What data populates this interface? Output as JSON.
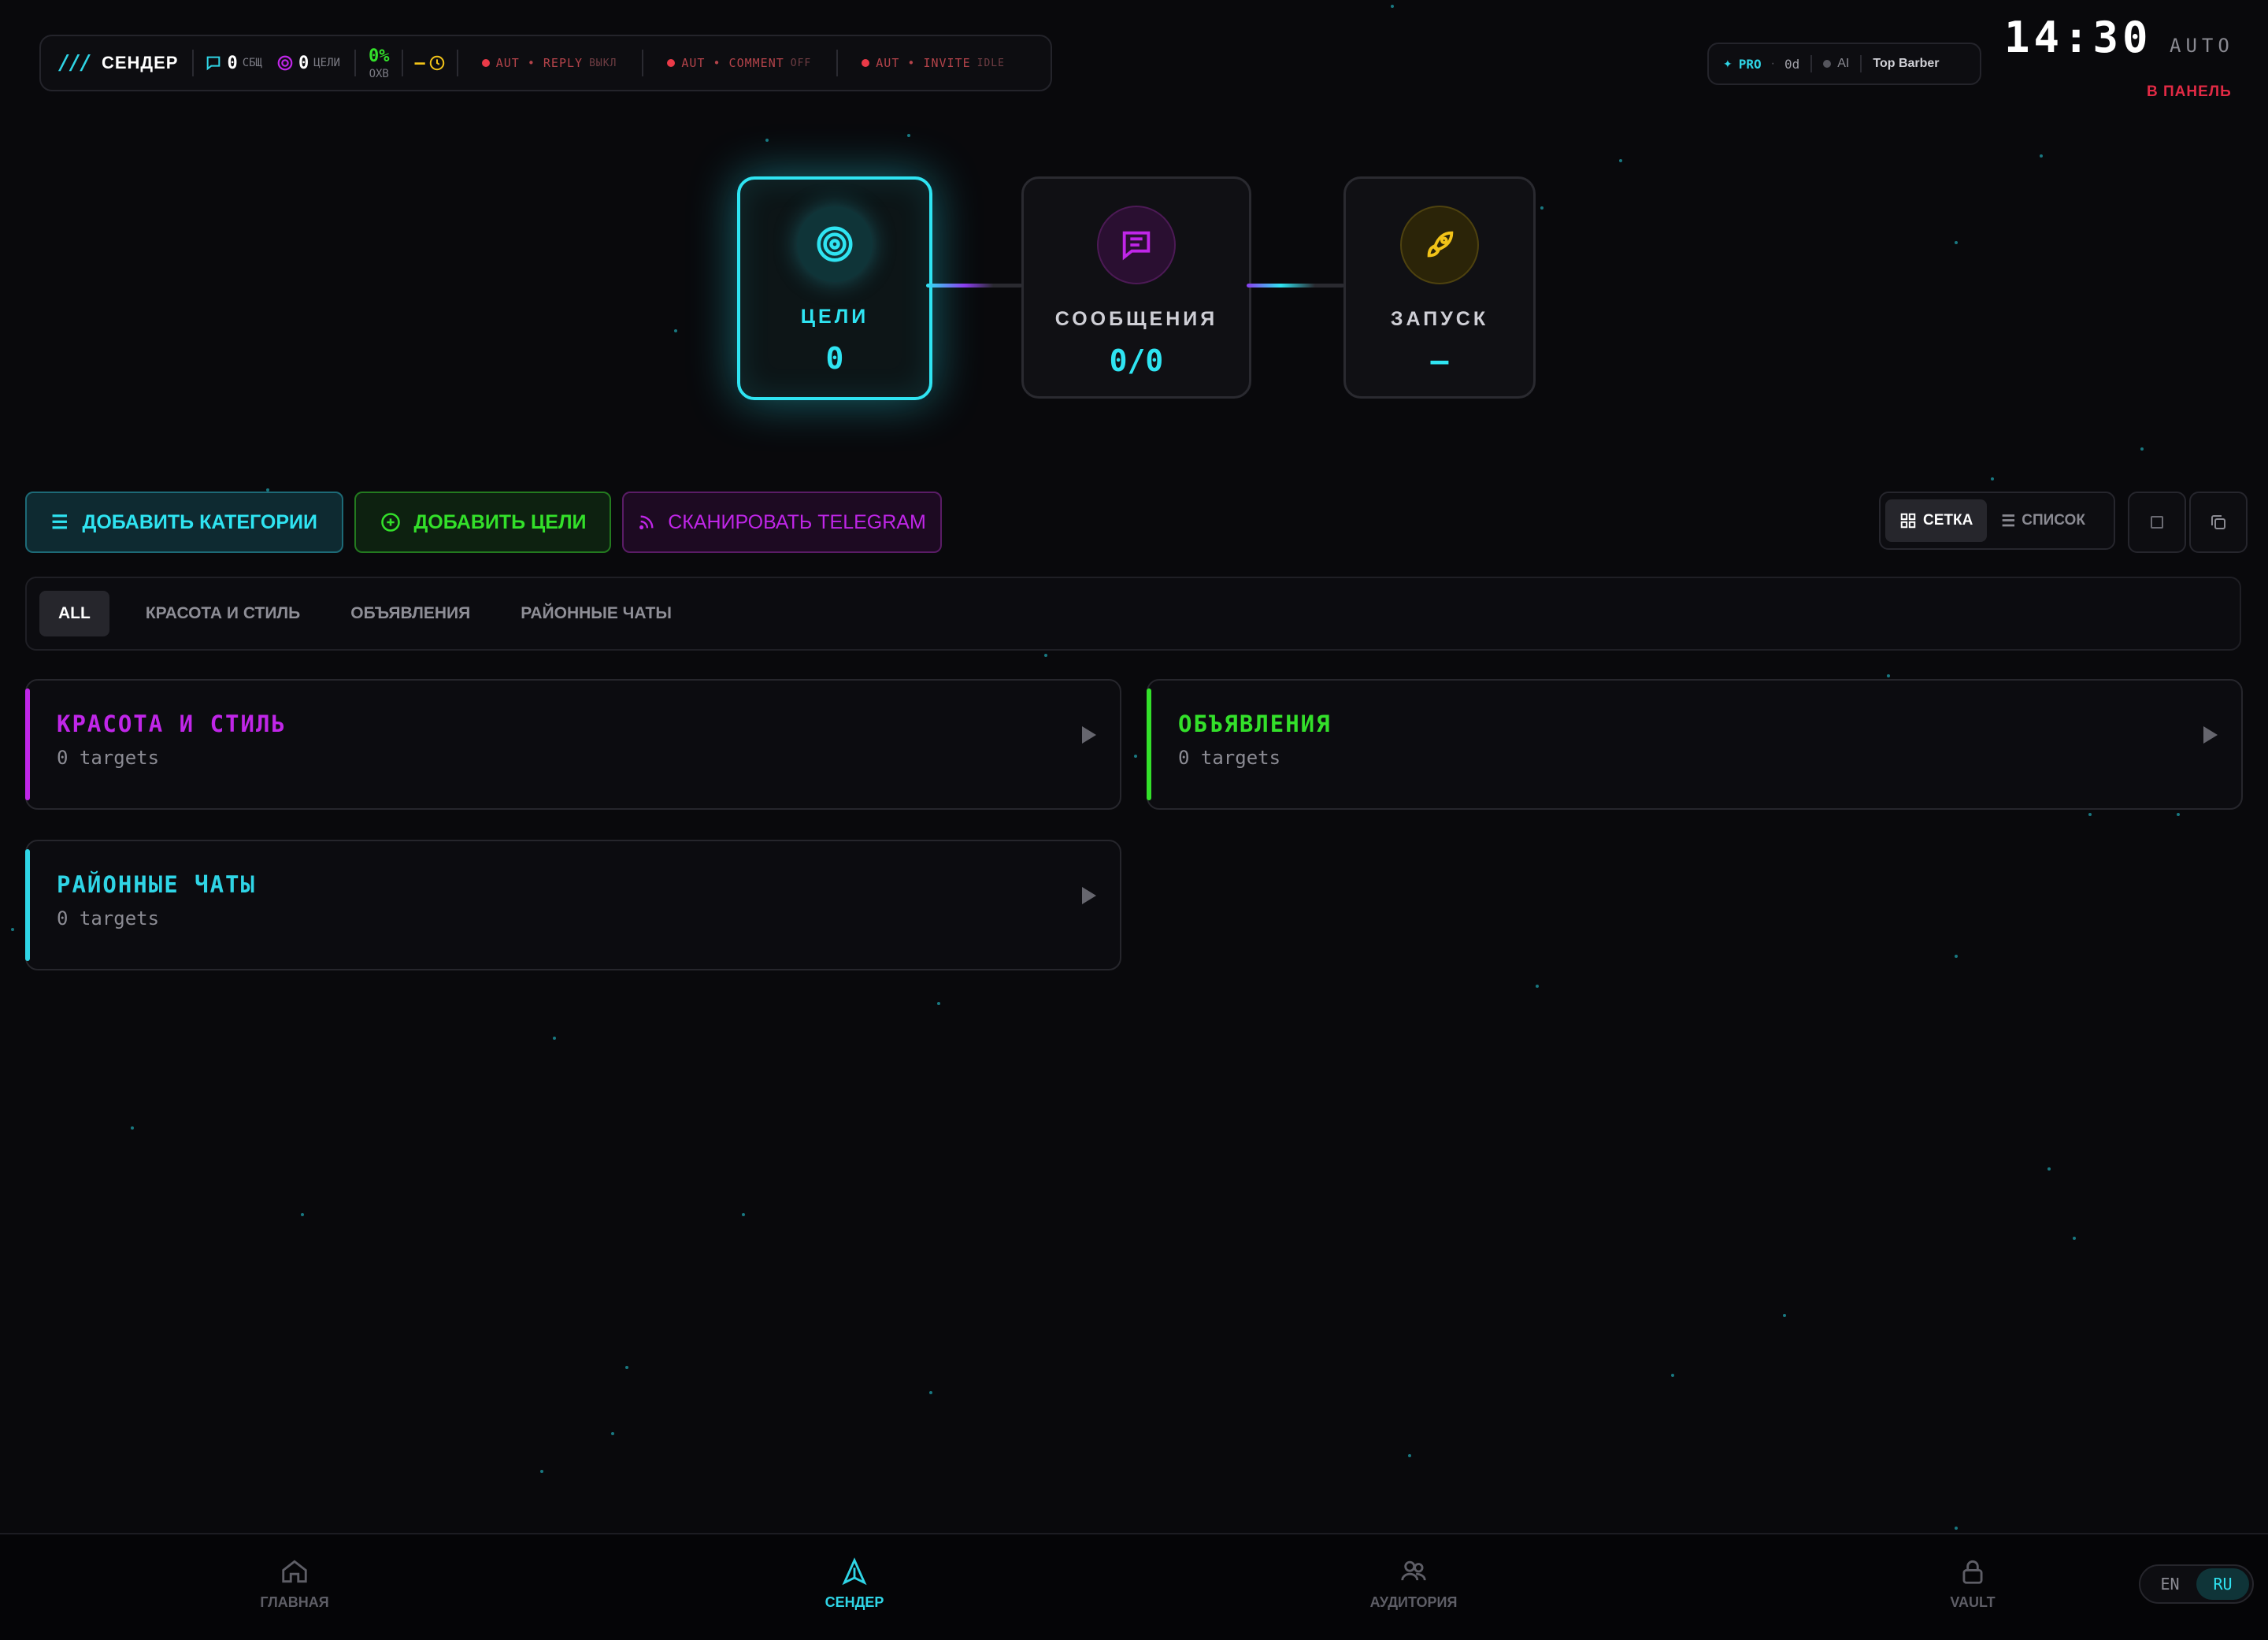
{
  "topbar": {
    "brand": "СЕНДЕР",
    "messages_count": "0",
    "messages_label": "СБЩ",
    "targets_count": "0",
    "targets_label": "ЦЕЛИ",
    "coverage_value": "0%",
    "coverage_label": "ОХВ",
    "auto_reply": {
      "name": "AUT • REPLY",
      "state": "ВЫКЛ"
    },
    "auto_comment": {
      "name": "AUT • COMMENT",
      "state": "OFF"
    },
    "auto_invite": {
      "name": "AUT • INVITE",
      "state": "IDLE"
    },
    "plan": "PRO",
    "days": "0d",
    "ai": "AI",
    "account": "Top Barber",
    "clock": "14:30",
    "mode": "AUTO",
    "panel_link": "В ПАНЕЛЬ"
  },
  "pipeline": {
    "steps": [
      {
        "label": "ЦЕЛИ",
        "value": "0"
      },
      {
        "label": "СООБЩЕНИЯ",
        "value": "0/0"
      },
      {
        "label": "ЗАПУСК",
        "value": "—"
      }
    ]
  },
  "actions": {
    "add_categories": "ДОБАВИТЬ КАТЕГОРИИ",
    "add_targets": "ДОБАВИТЬ ЦЕЛИ",
    "scan_telegram": "СКАНИРОВАТЬ TELEGRAM",
    "view_grid": "СЕТКА",
    "view_list": "СПИСОК"
  },
  "filters": [
    "ALL",
    "КРАСОТА И СТИЛЬ",
    "ОБЪЯВЛЕНИЯ",
    "РАЙОННЫЕ ЧАТЫ"
  ],
  "categories": [
    {
      "title": "КРАСОТА И СТИЛЬ",
      "count": "0 targets",
      "color": "#c026e8"
    },
    {
      "title": "ОБЪЯВЛЕНИЯ",
      "count": "0 targets",
      "color": "#33e02a"
    },
    {
      "title": "РАЙОННЫЕ ЧАТЫ",
      "count": "0 targets",
      "color": "#2fd5e6"
    }
  ],
  "nav": {
    "items": [
      {
        "label": "ГЛАВНАЯ",
        "icon": "home-icon"
      },
      {
        "label": "СЕНДЕР",
        "icon": "send-icon"
      },
      {
        "label": "АУДИТОРИЯ",
        "icon": "users-icon"
      },
      {
        "label": "VAULT",
        "icon": "lock-icon"
      }
    ],
    "active": "СЕНДЕР"
  },
  "language": {
    "options": [
      "EN",
      "RU"
    ],
    "selected": "RU"
  },
  "colors": {
    "accent_cyan": "#2fd5e6",
    "accent_purple": "#c026e8",
    "accent_green": "#33e02a",
    "accent_yellow": "#f2c318",
    "danger": "#e22a45"
  }
}
